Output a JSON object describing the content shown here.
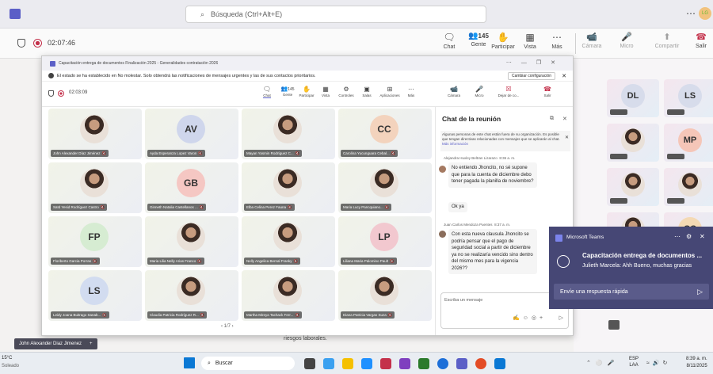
{
  "top": {
    "search": "Búsqueda (Ctrl+Alt+E)"
  },
  "call": {
    "timer": "02:07:46",
    "chat": "Chat",
    "people_count": "145",
    "people": "Gente",
    "participate": "Participar",
    "view": "Vista",
    "more": "Más",
    "camera": "Cámara",
    "mic": "Micro",
    "share": "Compartir",
    "leave": "Salir"
  },
  "gallery": {
    "dl": "DL",
    "ls": "LS",
    "mp": "MP",
    "cc": "CC"
  },
  "window": {
    "title": "Capacitación entrega de documentos Finalización 2025 - Generalidades contratación 2026",
    "banner": "El estado se ha establecido en No molestar. Solo obtendrá las notificaciones de mensajes urgentes y las de sus contactos prioritarios.",
    "banner_btn": "Cambiar configuración",
    "timer": "02:03:09",
    "toolbar": {
      "chat": "Chat",
      "people_count": "145",
      "people": "Gente",
      "participate": "Participar",
      "view": "Vista",
      "controls": "Controles",
      "rooms": "Salas",
      "apps": "Aplicaciones",
      "more": "Más",
      "camera": "Cámara",
      "mic": "Micro",
      "share": "Dejar de co...",
      "leave": "Salir"
    },
    "pagination": "1/7",
    "footer_text": "riesgos laborales."
  },
  "participants": [
    {
      "name": "John Alexander Díaz Jiménez",
      "initials": ""
    },
    {
      "name": "Ayda Esperanza Lopez Varon",
      "initials": "AV"
    },
    {
      "name": "Mayan Yasmin Rodríguez C...",
      "initials": ""
    },
    {
      "name": "Carolina Yucunguara Cebal...",
      "initials": "CC"
    },
    {
      "name": "Saïd Yesid Rodríguez Castro",
      "initials": ""
    },
    {
      "name": "Ginneth Natalia Castellanos ...",
      "initials": "GB"
    },
    {
      "name": "Elba Celina Perez Fauna",
      "initials": ""
    },
    {
      "name": "Maria Lucy Pancquiano...",
      "initials": ""
    },
    {
      "name": "Floriberto Garcia Porras",
      "initials": "FP"
    },
    {
      "name": "Maria Lilia Nelly Arias Franco",
      "initials": ""
    },
    {
      "name": "Nelly Angelica Bernal Franky",
      "initials": ""
    },
    {
      "name": "Liliana Maria Palomino Pault",
      "initials": "LP"
    },
    {
      "name": "Leidy Joana Buitrago Sanab...",
      "initials": "LS"
    },
    {
      "name": "Claudia Patricia Rodríguez R...",
      "initials": ""
    },
    {
      "name": "Martha Mireya Tachack Ferr...",
      "initials": ""
    },
    {
      "name": "Diana Patricia Vargas Suza",
      "initials": ""
    }
  ],
  "chat": {
    "title": "Chat de la reunión",
    "notice": "Algunas personas de este chat están fuera de su organización. Es posible que tengan directivas relacionadas con mensajes que se aplicarán al chat.",
    "notice_link": "Más información",
    "m1_author": "Alejandra Huxley Beltran Lizarazo",
    "m1_time": "8:36 a. m.",
    "m1_text": "No entiendo Jhoncito, no sé supone que para la cuenta de diciembre debo tener pagada la planilla de noviembre?",
    "m2_text": "Ok ya",
    "m3_author": "Juan Carlos Mendoza Puentes",
    "m3_time": "8:37 a. m.",
    "m3_text": "Con esta nueva clausula Jhoncito se podría pensar que el pago de seguridad social a partir de diciembre ya no se realizaría vencido sino dentro del mismo mes para la vigencia 2026??",
    "input_placeholder": "Escriba un mensaje"
  },
  "toast": {
    "app": "Microsoft Teams",
    "title": "Capacitación entrega de documentos ...",
    "body": "Julieth Marcela: Ahh Bueno, muchas gracias",
    "reply": "Envíe una respuesta rápida"
  },
  "presenter_bar": {
    "name": "John Alexander Diaz Jimenez"
  },
  "taskbar": {
    "temp": "15°C",
    "weather": "Soleado",
    "search": "Buscar",
    "lang": "ESP",
    "lang2": "LAA",
    "time": "8:39 a. m.",
    "date": "8/11/2025"
  },
  "colors": {
    "accent": "#5b5fc7",
    "leave": "#c4314b",
    "toast": "#464775"
  }
}
